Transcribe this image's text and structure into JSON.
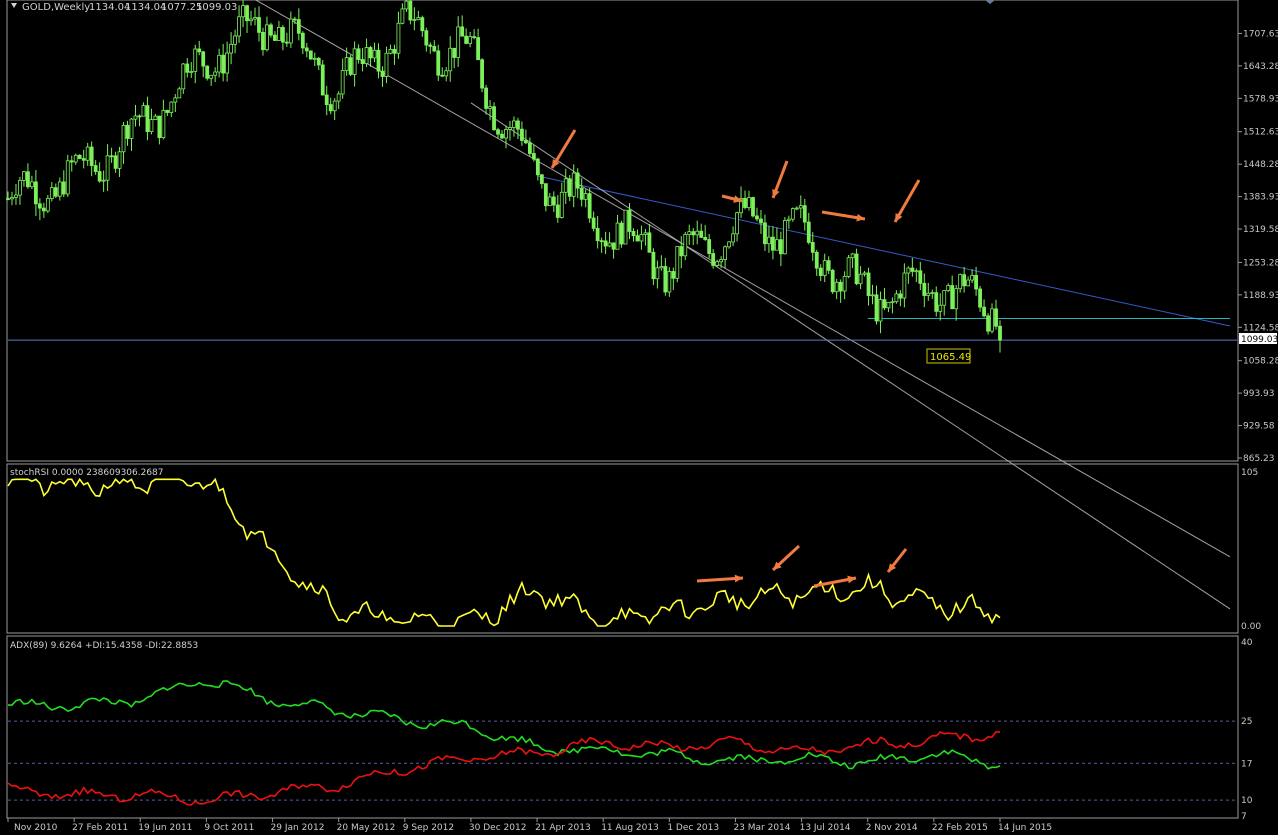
{
  "header": {
    "symbol_label": "GOLD,Weekly",
    "ohlc": [
      "1134.04",
      "1134.04",
      "1077.25",
      "1099.03"
    ]
  },
  "price_panel": {
    "price_ticks": [
      "1707.63",
      "1643.28",
      "1578.93",
      "1512.63",
      "1448.28",
      "1383.93",
      "1319.58",
      "1253.28",
      "1188.93",
      "1124.58",
      "1058.28",
      "993.93",
      "929.58",
      "865.23"
    ],
    "current_price": "1099.03",
    "annotation_label": "1065.49"
  },
  "stoch_panel": {
    "label": "stochRSI 0.0000 238609306.2687",
    "ticks": [
      "105",
      "0.00"
    ]
  },
  "adx_panel": {
    "label": "ADX(89) 9.6264 +DI:15.4358 -DI:22.8853",
    "ticks": [
      "40",
      "25",
      "17",
      "10",
      "7"
    ]
  },
  "x_axis": {
    "labels": [
      "Nov 2010",
      "27 Feb 2011",
      "19 Jun 2011",
      "9 Oct 2011",
      "29 Jan 2012",
      "20 May 2012",
      "9 Sep 2012",
      "30 Dec 2012",
      "21 Apr 2013",
      "11 Aug 2013",
      "1 Dec 2013",
      "23 Mar 2014",
      "13 Jul 2014",
      "2 Nov 2014",
      "22 Feb 2015",
      "14 Jun 2015"
    ]
  },
  "chart_data": [
    {
      "type": "candlestick",
      "title": "GOLD,Weekly",
      "x": [
        "Nov 2010",
        "27 Feb 2011",
        "19 Jun 2011",
        "9 Oct 2011",
        "29 Jan 2012",
        "20 May 2012",
        "9 Sep 2012",
        "30 Dec 2012",
        "21 Apr 2013",
        "11 Aug 2013",
        "1 Dec 2013",
        "23 Mar 2014",
        "13 Jul 2014",
        "2 Nov 2014",
        "22 Feb 2015",
        "14 Jun 2015"
      ],
      "series": [
        {
          "values": [
            1380,
            1420,
            1520,
            1660,
            1730,
            1600,
            1720,
            1660,
            1420,
            1340,
            1240,
            1330,
            1310,
            1180,
            1210,
            1160
          ]
        }
      ],
      "last_close": 1099.03,
      "ylim": [
        865.23,
        1770
      ],
      "color": "#7cf05a",
      "trendlines": [
        {
          "color": "#3f6bf0",
          "from": [
            "21 Apr 2013",
            1425
          ],
          "to": [
            "14 Jun 2015",
            1226
          ]
        },
        {
          "color": "#bfbfbf",
          "from": [
            "9 Oct 2011",
            1830
          ],
          "to": [
            "14 Jun 2015",
            930
          ]
        },
        {
          "color": "#bfbfbf",
          "from": [
            "30 Dec 2012",
            1570
          ],
          "to": [
            "14 Jun 2015",
            870
          ]
        },
        {
          "color": "#25d6d6",
          "from": [
            "2 Nov 2014",
            1142
          ],
          "to": [
            "14 Jun 2015",
            1142
          ]
        }
      ],
      "horizontal_line": {
        "value": 1099.03,
        "color": "#5a78d0"
      },
      "marked_level": 1065.49
    },
    {
      "type": "line",
      "title": "stochRSI 0.0000 238609306.2687",
      "x": [
        "Nov 2010",
        "27 Feb 2011",
        "19 Jun 2011",
        "9 Oct 2011",
        "29 Jan 2012",
        "20 May 2012",
        "9 Sep 2012",
        "30 Dec 2012",
        "21 Apr 2013",
        "11 Aug 2013",
        "1 Dec 2013",
        "23 Mar 2014",
        "13 Jul 2014",
        "2 Nov 2014",
        "22 Feb 2015",
        "14 Jun 2015"
      ],
      "series": [
        {
          "color": "#ffff33",
          "values": [
            100,
            95,
            98,
            100,
            50,
            10,
            4,
            2,
            25,
            3,
            10,
            18,
            22,
            26,
            14,
            10
          ]
        }
      ],
      "ylim": [
        0,
        105
      ]
    },
    {
      "type": "line",
      "title": "ADX(89) 9.6264 +DI:15.4358 -DI:22.8853",
      "x": [
        "Nov 2010",
        "27 Feb 2011",
        "19 Jun 2011",
        "9 Oct 2011",
        "29 Jan 2012",
        "20 May 2012",
        "9 Sep 2012",
        "30 Dec 2012",
        "21 Apr 2013",
        "11 Aug 2013",
        "1 Dec 2013",
        "23 Mar 2014",
        "13 Jul 2014",
        "2 Nov 2014",
        "22 Feb 2015",
        "14 Jun 2015"
      ],
      "series": [
        {
          "color": "#22dd22",
          "values": [
            28,
            28,
            29,
            33,
            29,
            27,
            25,
            24,
            20,
            19.5,
            18.5,
            17.5,
            18,
            17,
            19,
            16.5
          ]
        },
        {
          "color": "#ee1111",
          "values": [
            12,
            11,
            11,
            10,
            11.5,
            13,
            16,
            18,
            19,
            21,
            20,
            21,
            19,
            20.5,
            21.5,
            22.8885
          ]
        }
      ],
      "reference_levels": [
        25,
        17,
        10
      ],
      "ylim": [
        7,
        40
      ]
    }
  ]
}
